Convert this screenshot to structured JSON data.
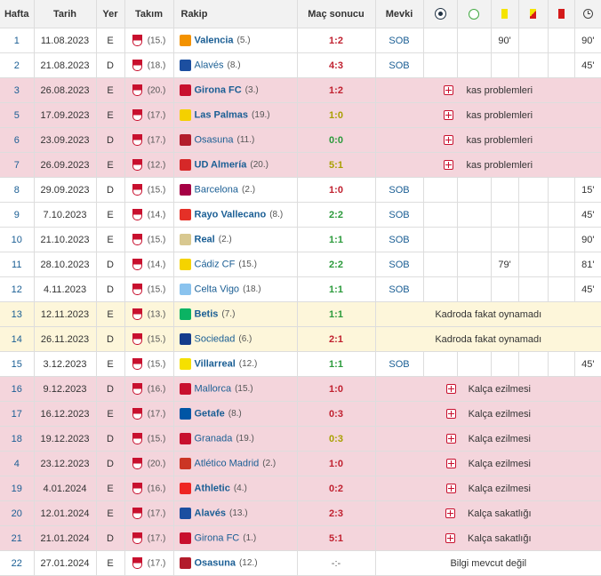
{
  "headers": {
    "week": "Hafta",
    "date": "Tarih",
    "venue": "Yer",
    "team": "Takım",
    "opponent": "Rakip",
    "result": "Maç sonucu",
    "position": "Mevki"
  },
  "header_icons": [
    "goal-icon",
    "assist-icon",
    "yellow-card-icon",
    "yellow-red-card-icon",
    "red-card-icon",
    "minutes-clock-icon"
  ],
  "rows": [
    {
      "week": "1",
      "date": "11.08.2023",
      "venue": "E",
      "team_rank": "(15.)",
      "opponent": "Valencia",
      "opp_rank": "(5.)",
      "opp_bold": true,
      "result": "1:2",
      "res": "l",
      "type": "played",
      "position": "SOB",
      "goal": "",
      "assist": "",
      "yellow": "90'",
      "yr": "",
      "red": "",
      "minutes": "90'",
      "opp_color": "#f39200"
    },
    {
      "week": "2",
      "date": "21.08.2023",
      "venue": "D",
      "team_rank": "(18.)",
      "opponent": "Alavés",
      "opp_rank": "(8.)",
      "opp_bold": false,
      "result": "4:3",
      "res": "l",
      "type": "played",
      "position": "SOB",
      "goal": "",
      "assist": "",
      "yellow": "",
      "yr": "",
      "red": "",
      "minutes": "45'",
      "opp_color": "#1c4fa0"
    },
    {
      "week": "3",
      "date": "26.08.2023",
      "venue": "E",
      "team_rank": "(20.)",
      "opponent": "Girona FC",
      "opp_rank": "(3.)",
      "opp_bold": true,
      "result": "1:2",
      "res": "l",
      "type": "injury",
      "note": "kas problemleri",
      "opp_color": "#c8102e"
    },
    {
      "week": "5",
      "date": "17.09.2023",
      "venue": "E",
      "team_rank": "(17.)",
      "opponent": "Las Palmas",
      "opp_rank": "(19.)",
      "opp_bold": true,
      "result": "1:0",
      "res": "d",
      "type": "injury",
      "note": "kas problemleri",
      "opp_color": "#f4d000"
    },
    {
      "week": "6",
      "date": "23.09.2023",
      "venue": "D",
      "team_rank": "(17.)",
      "opponent": "Osasuna",
      "opp_rank": "(11.)",
      "opp_bold": false,
      "result": "0:0",
      "res": "w",
      "type": "injury",
      "note": "kas problemleri",
      "opp_color": "#b21c2b"
    },
    {
      "week": "7",
      "date": "26.09.2023",
      "venue": "E",
      "team_rank": "(12.)",
      "opponent": "UD Almería",
      "opp_rank": "(20.)",
      "opp_bold": true,
      "result": "5:1",
      "res": "d",
      "type": "injury",
      "note": "kas problemleri",
      "opp_color": "#d62828"
    },
    {
      "week": "8",
      "date": "29.09.2023",
      "venue": "D",
      "team_rank": "(15.)",
      "opponent": "Barcelona",
      "opp_rank": "(2.)",
      "opp_bold": false,
      "result": "1:0",
      "res": "l",
      "type": "played",
      "position": "SOB",
      "goal": "",
      "assist": "",
      "yellow": "",
      "yr": "",
      "red": "",
      "minutes": "15'",
      "opp_color": "#a50044"
    },
    {
      "week": "9",
      "date": "7.10.2023",
      "venue": "E",
      "team_rank": "(14.)",
      "opponent": "Rayo Vallecano",
      "opp_rank": "(8.)",
      "opp_bold": true,
      "result": "2:2",
      "res": "w",
      "type": "played",
      "position": "SOB",
      "goal": "",
      "assist": "",
      "yellow": "",
      "yr": "",
      "red": "",
      "minutes": "45'",
      "opp_color": "#e53027"
    },
    {
      "week": "10",
      "date": "21.10.2023",
      "venue": "E",
      "team_rank": "(15.)",
      "opponent": "Real",
      "opp_rank": "(2.)",
      "opp_bold": true,
      "result": "1:1",
      "res": "w",
      "type": "played",
      "position": "SOB",
      "goal": "",
      "assist": "",
      "yellow": "",
      "yr": "",
      "red": "",
      "minutes": "90'",
      "opp_color": "#d8c890"
    },
    {
      "week": "11",
      "date": "28.10.2023",
      "venue": "D",
      "team_rank": "(14.)",
      "opponent": "Cádiz CF",
      "opp_rank": "(15.)",
      "opp_bold": false,
      "result": "2:2",
      "res": "w",
      "type": "played",
      "position": "SOB",
      "goal": "",
      "assist": "",
      "yellow": "79'",
      "yr": "",
      "red": "",
      "minutes": "81'",
      "opp_color": "#f5d300"
    },
    {
      "week": "12",
      "date": "4.11.2023",
      "venue": "D",
      "team_rank": "(15.)",
      "opponent": "Celta Vigo",
      "opp_rank": "(18.)",
      "opp_bold": false,
      "result": "1:1",
      "res": "w",
      "type": "played",
      "position": "SOB",
      "goal": "",
      "assist": "",
      "yellow": "",
      "yr": "",
      "red": "",
      "minutes": "45'",
      "opp_color": "#8ac3ee"
    },
    {
      "week": "13",
      "date": "12.11.2023",
      "venue": "E",
      "team_rank": "(13.)",
      "opponent": "Betis",
      "opp_rank": "(7.)",
      "opp_bold": true,
      "result": "1:1",
      "res": "w",
      "type": "bench",
      "note": "Kadroda fakat oynamadı",
      "opp_color": "#0bb363"
    },
    {
      "week": "14",
      "date": "26.11.2023",
      "venue": "D",
      "team_rank": "(15.)",
      "opponent": "Sociedad",
      "opp_rank": "(6.)",
      "opp_bold": false,
      "result": "2:1",
      "res": "l",
      "type": "bench",
      "note": "Kadroda fakat oynamadı",
      "opp_color": "#143c8c"
    },
    {
      "week": "15",
      "date": "3.12.2023",
      "venue": "E",
      "team_rank": "(15.)",
      "opponent": "Villarreal",
      "opp_rank": "(12.)",
      "opp_bold": true,
      "result": "1:1",
      "res": "w",
      "type": "played",
      "position": "SOB",
      "goal": "",
      "assist": "",
      "yellow": "",
      "yr": "",
      "red": "",
      "minutes": "45'",
      "opp_color": "#f5e000"
    },
    {
      "week": "16",
      "date": "9.12.2023",
      "venue": "D",
      "team_rank": "(16.)",
      "opponent": "Mallorca",
      "opp_rank": "(15.)",
      "opp_bold": false,
      "result": "1:0",
      "res": "l",
      "type": "injury",
      "note": "Kalça ezilmesi",
      "opp_color": "#c8102e"
    },
    {
      "week": "17",
      "date": "16.12.2023",
      "venue": "E",
      "team_rank": "(17.)",
      "opponent": "Getafe",
      "opp_rank": "(8.)",
      "opp_bold": true,
      "result": "0:3",
      "res": "l",
      "type": "injury",
      "note": "Kalça ezilmesi",
      "opp_color": "#0055a5"
    },
    {
      "week": "18",
      "date": "19.12.2023",
      "venue": "D",
      "team_rank": "(15.)",
      "opponent": "Granada",
      "opp_rank": "(19.)",
      "opp_bold": false,
      "result": "0:3",
      "res": "d",
      "type": "injury",
      "note": "Kalça ezilmesi",
      "opp_color": "#c8102e"
    },
    {
      "week": "4",
      "date": "23.12.2023",
      "venue": "D",
      "team_rank": "(20.)",
      "opponent": "Atlético Madrid",
      "opp_rank": "(2.)",
      "opp_bold": false,
      "result": "1:0",
      "res": "l",
      "type": "injury",
      "note": "Kalça ezilmesi",
      "opp_color": "#cb3524"
    },
    {
      "week": "19",
      "date": "4.01.2024",
      "venue": "E",
      "team_rank": "(16.)",
      "opponent": "Athletic",
      "opp_rank": "(4.)",
      "opp_bold": true,
      "result": "0:2",
      "res": "l",
      "type": "injury",
      "note": "Kalça ezilmesi",
      "opp_color": "#ee2523"
    },
    {
      "week": "20",
      "date": "12.01.2024",
      "venue": "E",
      "team_rank": "(17.)",
      "opponent": "Alavés",
      "opp_rank": "(13.)",
      "opp_bold": true,
      "result": "2:3",
      "res": "l",
      "type": "injury",
      "note": "Kalça sakatlığı",
      "opp_color": "#1c4fa0"
    },
    {
      "week": "21",
      "date": "21.01.2024",
      "venue": "D",
      "team_rank": "(17.)",
      "opponent": "Girona FC",
      "opp_rank": "(1.)",
      "opp_bold": false,
      "result": "5:1",
      "res": "l",
      "type": "injury",
      "note": "Kalça sakatlığı",
      "opp_color": "#c8102e"
    },
    {
      "week": "22",
      "date": "27.01.2024",
      "venue": "E",
      "team_rank": "(17.)",
      "opponent": "Osasuna",
      "opp_rank": "(12.)",
      "opp_bold": true,
      "result": "-:-",
      "res": "n",
      "type": "nodata",
      "note": "Bilgi mevcut değil",
      "opp_color": "#b21c2b"
    }
  ]
}
